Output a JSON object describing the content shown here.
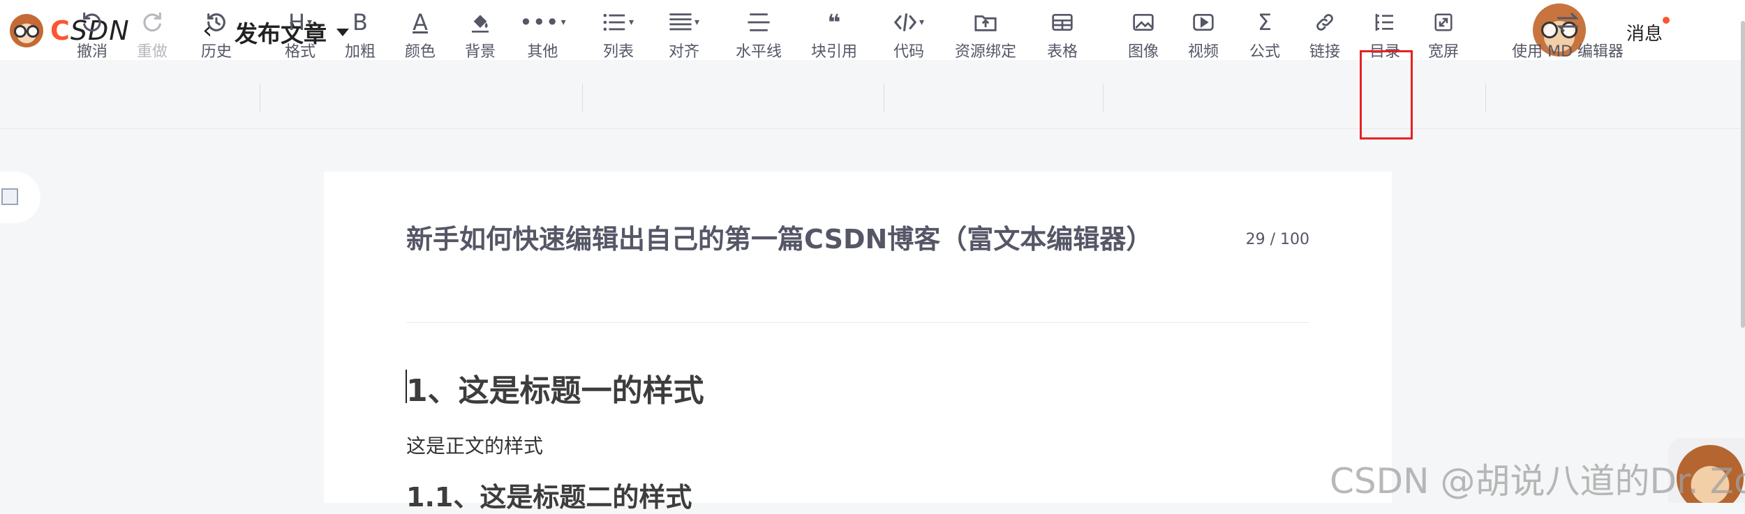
{
  "header": {
    "logo_text_c": "C",
    "logo_text_rest": "SDN",
    "page_title": "发布文章",
    "messages_label": "消息"
  },
  "toolbar": {
    "items": [
      {
        "label": "撤消",
        "icon": "undo-icon"
      },
      {
        "label": "重做",
        "icon": "redo-icon",
        "disabled": true
      },
      {
        "label": "历史",
        "icon": "history-icon"
      },
      {
        "label": "格式",
        "icon": "heading-icon",
        "glyph": "H"
      },
      {
        "label": "加粗",
        "icon": "bold-icon",
        "glyph": "B"
      },
      {
        "label": "颜色",
        "icon": "text-color-icon",
        "glyph": "A"
      },
      {
        "label": "背景",
        "icon": "paint-bucket-icon"
      },
      {
        "label": "其他",
        "icon": "more-icon"
      },
      {
        "label": "列表",
        "icon": "list-icon"
      },
      {
        "label": "对齐",
        "icon": "align-icon"
      },
      {
        "label": "水平线",
        "icon": "horizontal-line-icon"
      },
      {
        "label": "块引用",
        "icon": "quote-icon"
      },
      {
        "label": "代码",
        "icon": "code-icon"
      },
      {
        "label": "资源绑定",
        "icon": "resource-upload-icon"
      },
      {
        "label": "表格",
        "icon": "table-icon"
      },
      {
        "label": "图像",
        "icon": "image-icon"
      },
      {
        "label": "视频",
        "icon": "video-icon"
      },
      {
        "label": "公式",
        "icon": "formula-icon",
        "glyph": "Σ"
      },
      {
        "label": "链接",
        "icon": "link-icon"
      },
      {
        "label": "目录",
        "icon": "toc-icon"
      },
      {
        "label": "宽屏",
        "icon": "widescreen-icon"
      },
      {
        "label": "使用 MD 编辑器",
        "icon": "switch-editor-icon"
      }
    ]
  },
  "editor": {
    "title": "新手如何快速编辑出自己的第一篇CSDN博客（富文本编辑器）",
    "title_count": "29 / 100",
    "heading1": "1、这是标题一的样式",
    "body": "这是正文的样式",
    "heading2": "1.1、这是标题二的样式"
  },
  "watermark": "CSDN @胡说八道的Dr. Zou",
  "colors": {
    "brand": "#fc5531",
    "highlight_box": "#e62222",
    "toolbar_text": "#555666"
  }
}
